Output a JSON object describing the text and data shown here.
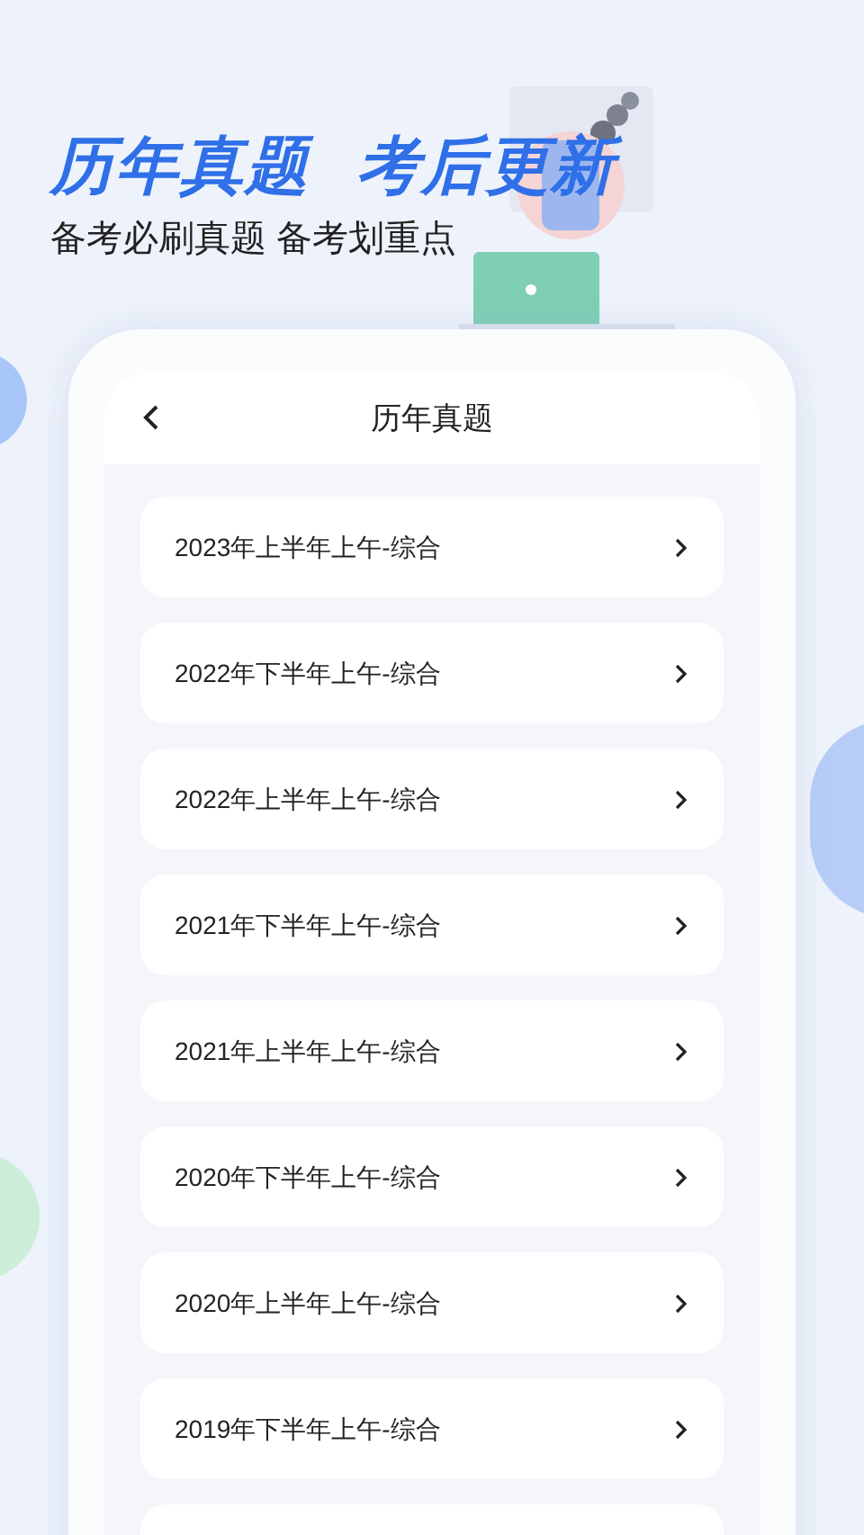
{
  "headline": {
    "left": "历年真题",
    "right": "考后更新"
  },
  "subtitle": "备考必刷真题 备考划重点",
  "screen": {
    "title": "历年真题",
    "items": [
      {
        "label": "2023年上半年上午-综合"
      },
      {
        "label": "2022年下半年上午-综合"
      },
      {
        "label": "2022年上半年上午-综合"
      },
      {
        "label": "2021年下半年上午-综合"
      },
      {
        "label": "2021年上半年上午-综合"
      },
      {
        "label": "2020年下半年上午-综合"
      },
      {
        "label": "2020年上半年上午-综合"
      },
      {
        "label": "2019年下半年上午-综合"
      }
    ]
  }
}
